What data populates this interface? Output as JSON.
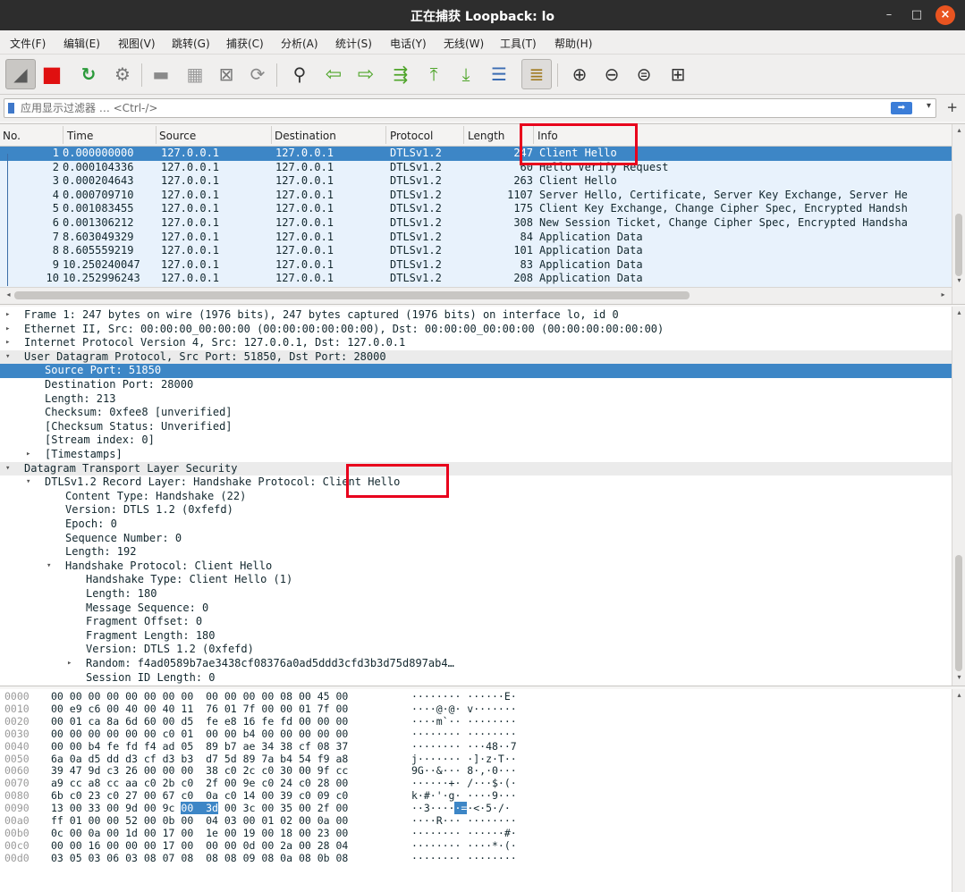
{
  "window": {
    "title": "正在捕获 Loopback: lo",
    "min": "–",
    "max": "□",
    "close": "×"
  },
  "menu": [
    "文件(F)",
    "编辑(E)",
    "视图(V)",
    "跳转(G)",
    "捕获(C)",
    "分析(A)",
    "统计(S)",
    "电话(Y)",
    "无线(W)",
    "工具(T)",
    "帮助(H)"
  ],
  "toolbar": [
    {
      "name": "shark-fin-start-icon",
      "glyph": "◢"
    },
    {
      "name": "stop-capture-icon",
      "glyph": "■"
    },
    {
      "name": "restart-capture-icon",
      "glyph": "↻"
    },
    {
      "name": "capture-options-icon",
      "glyph": "⚙"
    },
    {
      "name": "open-file-icon",
      "glyph": "▬"
    },
    {
      "name": "save-file-icon",
      "glyph": "▦"
    },
    {
      "name": "close-file-icon",
      "glyph": "⊠"
    },
    {
      "name": "reload-file-icon",
      "glyph": "⟳"
    },
    {
      "name": "find-packet-icon",
      "glyph": "⚲"
    },
    {
      "name": "go-back-icon",
      "glyph": "⇦"
    },
    {
      "name": "go-forward-icon",
      "glyph": "⇨"
    },
    {
      "name": "go-to-packet-icon",
      "glyph": "⇶"
    },
    {
      "name": "first-packet-icon",
      "glyph": "⤒"
    },
    {
      "name": "last-packet-icon",
      "glyph": "⤓"
    },
    {
      "name": "auto-scroll-icon",
      "glyph": "☰"
    },
    {
      "name": "colorize-icon",
      "glyph": "≣"
    },
    {
      "name": "zoom-in-icon",
      "glyph": "⊕"
    },
    {
      "name": "zoom-out-icon",
      "glyph": "⊖"
    },
    {
      "name": "normal-size-icon",
      "glyph": "⊜"
    },
    {
      "name": "resize-columns-icon",
      "glyph": "⊞"
    }
  ],
  "filter": {
    "placeholder": "应用显示过滤器 … <Ctrl-/>",
    "apply": "➡",
    "dropdown": "▾",
    "add": "+"
  },
  "columns": [
    "No.",
    "Time",
    "Source",
    "Destination",
    "Protocol",
    "Length",
    "Info"
  ],
  "packets": [
    {
      "no": "1",
      "time": "0.000000000",
      "src": "127.0.0.1",
      "dst": "127.0.0.1",
      "proto": "DTLSv1.2",
      "len": "247",
      "info": "Client Hello"
    },
    {
      "no": "2",
      "time": "0.000104336",
      "src": "127.0.0.1",
      "dst": "127.0.0.1",
      "proto": "DTLSv1.2",
      "len": "60",
      "info": "Hello Verify Request"
    },
    {
      "no": "3",
      "time": "0.000204643",
      "src": "127.0.0.1",
      "dst": "127.0.0.1",
      "proto": "DTLSv1.2",
      "len": "263",
      "info": "Client Hello"
    },
    {
      "no": "4",
      "time": "0.000709710",
      "src": "127.0.0.1",
      "dst": "127.0.0.1",
      "proto": "DTLSv1.2",
      "len": "1107",
      "info": "Server Hello, Certificate, Server Key Exchange, Server He"
    },
    {
      "no": "5",
      "time": "0.001083455",
      "src": "127.0.0.1",
      "dst": "127.0.0.1",
      "proto": "DTLSv1.2",
      "len": "175",
      "info": "Client Key Exchange, Change Cipher Spec, Encrypted Handsh"
    },
    {
      "no": "6",
      "time": "0.001306212",
      "src": "127.0.0.1",
      "dst": "127.0.0.1",
      "proto": "DTLSv1.2",
      "len": "308",
      "info": "New Session Ticket, Change Cipher Spec, Encrypted Handsha"
    },
    {
      "no": "7",
      "time": "8.603049329",
      "src": "127.0.0.1",
      "dst": "127.0.0.1",
      "proto": "DTLSv1.2",
      "len": "84",
      "info": "Application Data"
    },
    {
      "no": "8",
      "time": "8.605559219",
      "src": "127.0.0.1",
      "dst": "127.0.0.1",
      "proto": "DTLSv1.2",
      "len": "101",
      "info": "Application Data"
    },
    {
      "no": "9",
      "time": "10.250240047",
      "src": "127.0.0.1",
      "dst": "127.0.0.1",
      "proto": "DTLSv1.2",
      "len": "83",
      "info": "Application Data"
    },
    {
      "no": "10",
      "time": "10.252996243",
      "src": "127.0.0.1",
      "dst": "127.0.0.1",
      "proto": "DTLSv1.2",
      "len": "208",
      "info": "Application Data"
    }
  ],
  "details": [
    {
      "indent": 0,
      "arrow": "▸",
      "text": "Frame 1: 247 bytes on wire (1976 bits), 247 bytes captured (1976 bits) on interface lo, id 0"
    },
    {
      "indent": 0,
      "arrow": "▸",
      "text": "Ethernet II, Src: 00:00:00_00:00:00 (00:00:00:00:00:00), Dst: 00:00:00_00:00:00 (00:00:00:00:00:00)"
    },
    {
      "indent": 0,
      "arrow": "▸",
      "text": "Internet Protocol Version 4, Src: 127.0.0.1, Dst: 127.0.0.1"
    },
    {
      "indent": 0,
      "arrow": "▾",
      "text": "User Datagram Protocol, Src Port: 51850, Dst Port: 28000",
      "grey": true
    },
    {
      "indent": 1,
      "arrow": "",
      "text": "Source Port: 51850",
      "sel": true
    },
    {
      "indent": 1,
      "arrow": "",
      "text": "Destination Port: 28000"
    },
    {
      "indent": 1,
      "arrow": "",
      "text": "Length: 213"
    },
    {
      "indent": 1,
      "arrow": "",
      "text": "Checksum: 0xfee8 [unverified]"
    },
    {
      "indent": 1,
      "arrow": "",
      "text": "[Checksum Status: Unverified]"
    },
    {
      "indent": 1,
      "arrow": "",
      "text": "[Stream index: 0]"
    },
    {
      "indent": 1,
      "arrow": "▸",
      "text": "[Timestamps]"
    },
    {
      "indent": 0,
      "arrow": "▾",
      "text": "Datagram Transport Layer Security",
      "grey": true
    },
    {
      "indent": 1,
      "arrow": "▾",
      "text": "DTLSv1.2 Record Layer: Handshake Protocol: Client Hello"
    },
    {
      "indent": 2,
      "arrow": "",
      "text": "Content Type: Handshake (22)"
    },
    {
      "indent": 2,
      "arrow": "",
      "text": "Version: DTLS 1.2 (0xfefd)"
    },
    {
      "indent": 2,
      "arrow": "",
      "text": "Epoch: 0"
    },
    {
      "indent": 2,
      "arrow": "",
      "text": "Sequence Number: 0"
    },
    {
      "indent": 2,
      "arrow": "",
      "text": "Length: 192"
    },
    {
      "indent": 2,
      "arrow": "▾",
      "text": "Handshake Protocol: Client Hello"
    },
    {
      "indent": 3,
      "arrow": "",
      "text": "Handshake Type: Client Hello (1)"
    },
    {
      "indent": 3,
      "arrow": "",
      "text": "Length: 180"
    },
    {
      "indent": 3,
      "arrow": "",
      "text": "Message Sequence: 0"
    },
    {
      "indent": 3,
      "arrow": "",
      "text": "Fragment Offset: 0"
    },
    {
      "indent": 3,
      "arrow": "",
      "text": "Fragment Length: 180"
    },
    {
      "indent": 3,
      "arrow": "",
      "text": "Version: DTLS 1.2 (0xfefd)"
    },
    {
      "indent": 3,
      "arrow": "▸",
      "text": "Random: f4ad0589b7ae3438cf08376a0ad5ddd3cfd3b3d75d897ab4…"
    },
    {
      "indent": 3,
      "arrow": "",
      "text": "Session ID Length: 0"
    }
  ],
  "bytes": [
    {
      "off": "0000",
      "hex": "00 00 00 00 00 00 00 00  00 00 00 00 08 00 45 00",
      "asc": "········ ······E·"
    },
    {
      "off": "0010",
      "hex": "00 e9 c6 00 40 00 40 11  76 01 7f 00 00 01 7f 00",
      "asc": "····@·@· v·······"
    },
    {
      "off": "0020",
      "hex": "00 01 ca 8a 6d 60 00 d5  fe e8 16 fe fd 00 00 00",
      "asc": "····m`·· ········"
    },
    {
      "off": "0030",
      "hex": "00 00 00 00 00 00 c0 01  00 00 b4 00 00 00 00 00",
      "asc": "········ ········"
    },
    {
      "off": "0040",
      "hex": "00 00 b4 fe fd f4 ad 05  89 b7 ae 34 38 cf 08 37",
      "asc": "········ ···48··7"
    },
    {
      "off": "0050",
      "hex": "6a 0a d5 dd d3 cf d3 b3  d7 5d 89 7a b4 54 f9 a8",
      "asc": "j······· ·]·z·T··"
    },
    {
      "off": "0060",
      "hex": "39 47 9d c3 26 00 00 00  38 c0 2c c0 30 00 9f cc",
      "asc": "9G··&··· 8·,·0···"
    },
    {
      "off": "0070",
      "hex": "a9 cc a8 cc aa c0 2b c0  2f 00 9e c0 24 c0 28 00",
      "asc": "······+· /···$·(·"
    },
    {
      "off": "0080",
      "hex": "6b c0 23 c0 27 00 67 c0  0a c0 14 00 39 c0 09 c0",
      "asc": "k·#·'·g· ····9···"
    },
    {
      "off": "0090",
      "hex_a": "13 00 33 00 9d 00 9c ",
      "hex_hl": "00  3d",
      "hex_b": " 00 3c 00 35 00 2f 00",
      "asc_a": "··3····",
      "asc_hl": "·=",
      "asc_b": "·<·5·/·"
    },
    {
      "off": "00a0",
      "hex": "ff 01 00 00 52 00 0b 00  04 03 00 01 02 00 0a 00",
      "asc": "····R··· ········"
    },
    {
      "off": "00b0",
      "hex": "0c 00 0a 00 1d 00 17 00  1e 00 19 00 18 00 23 00",
      "asc": "········ ······#·"
    },
    {
      "off": "00c0",
      "hex": "00 00 16 00 00 00 17 00  00 00 0d 00 2a 00 28 04",
      "asc": "········ ····*·(·"
    },
    {
      "off": "00d0",
      "hex": "03 05 03 06 03 08 07 08  08 08 09 08 0a 08 0b 08",
      "asc": "········ ········"
    }
  ]
}
